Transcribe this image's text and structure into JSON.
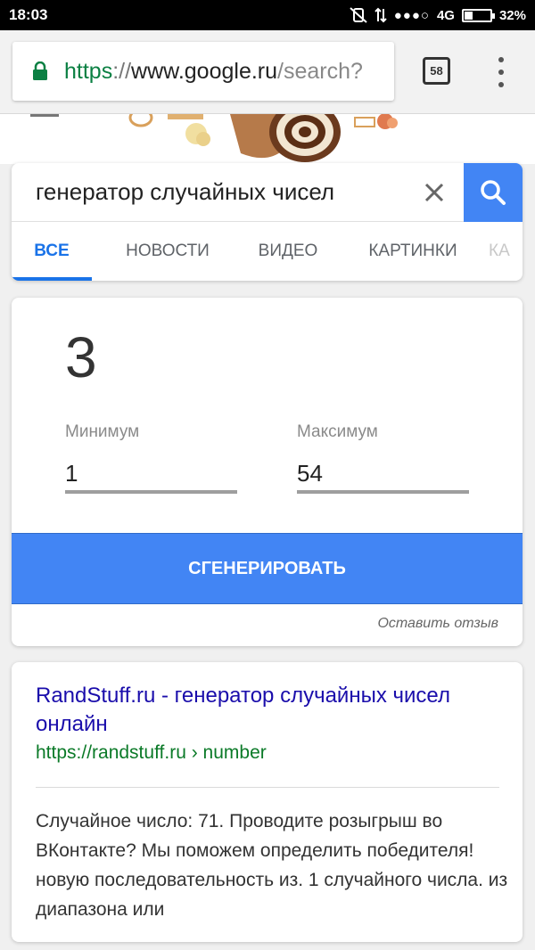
{
  "status_bar": {
    "time": "18:03",
    "network": "4G",
    "battery_percent": "32%",
    "battery_level": 0.32
  },
  "browser": {
    "url_scheme": "https",
    "url_separator": "://",
    "url_host": "www.google.ru",
    "url_path": "/search?",
    "tab_count": "58"
  },
  "search": {
    "query": "генератор случайных чисел",
    "tabs": [
      "ВСЕ",
      "НОВОСТИ",
      "ВИДЕО",
      "КАРТИНКИ",
      "КА"
    ]
  },
  "rng": {
    "result": "3",
    "min_label": "Минимум",
    "min_value": "1",
    "max_label": "Максимум",
    "max_value": "54",
    "generate_label": "СГЕНЕРИРОВАТЬ",
    "feedback_label": "Оставить отзыв"
  },
  "result": {
    "title": "RandStuff.ru - генератор случайных чисел онлайн",
    "url": "https://randstuff.ru › number",
    "snippet": "Случайное число: 71. Проводите розыгрыш во ВКонтакте? Мы поможем определить победителя! новую последовательность из. 1 случайного числа. из диапазона или"
  },
  "colors": {
    "accent": "#4285f4",
    "link": "#1a0dab",
    "url_green": "#0b7a28"
  }
}
